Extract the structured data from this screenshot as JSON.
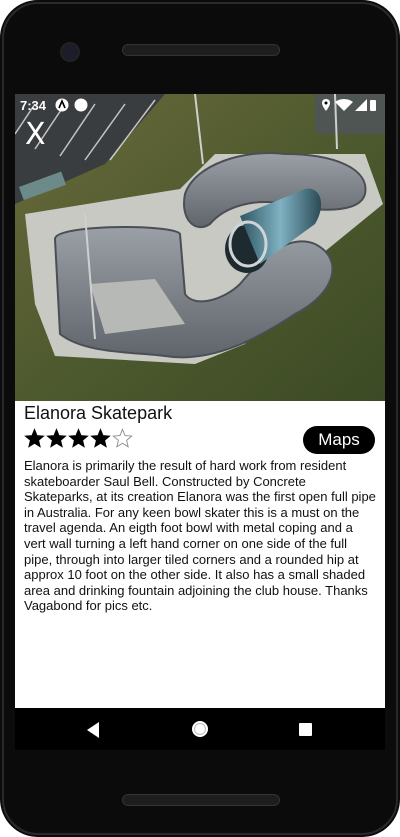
{
  "status_bar": {
    "time": "7:34",
    "left_icons": [
      "android-auto-icon",
      "circle-icon"
    ],
    "right_icons": [
      "location-icon",
      "wifi-icon",
      "signal-icon",
      "battery-icon"
    ]
  },
  "header": {
    "close_label": "X"
  },
  "park": {
    "name": "Elanora Skatepark",
    "rating": 4,
    "rating_max": 5,
    "description": "Elanora is primarily the result of hard work from resident skateboarder Saul Bell. Constructed by Concrete Skateparks, at its creation Elanora was the first open full pipe in Australia.  For any keen bowl skater this is a must on the travel agenda.  An eigth foot bowl with metal coping and a vert wall turning a left hand corner on one side of the full pipe, through into larger tiled corners and a rounded hip at approx 10 foot on the other side.  It also has a small shaded area and drinking fountain adjoining the club house.  Thanks Vagabond for pics etc."
  },
  "actions": {
    "maps_label": "Maps"
  },
  "nav_bar": {
    "buttons": [
      "back-icon",
      "home-icon",
      "recents-icon"
    ]
  },
  "colors": {
    "accent": "#000000",
    "star": "#000000",
    "background": "#ffffff"
  }
}
